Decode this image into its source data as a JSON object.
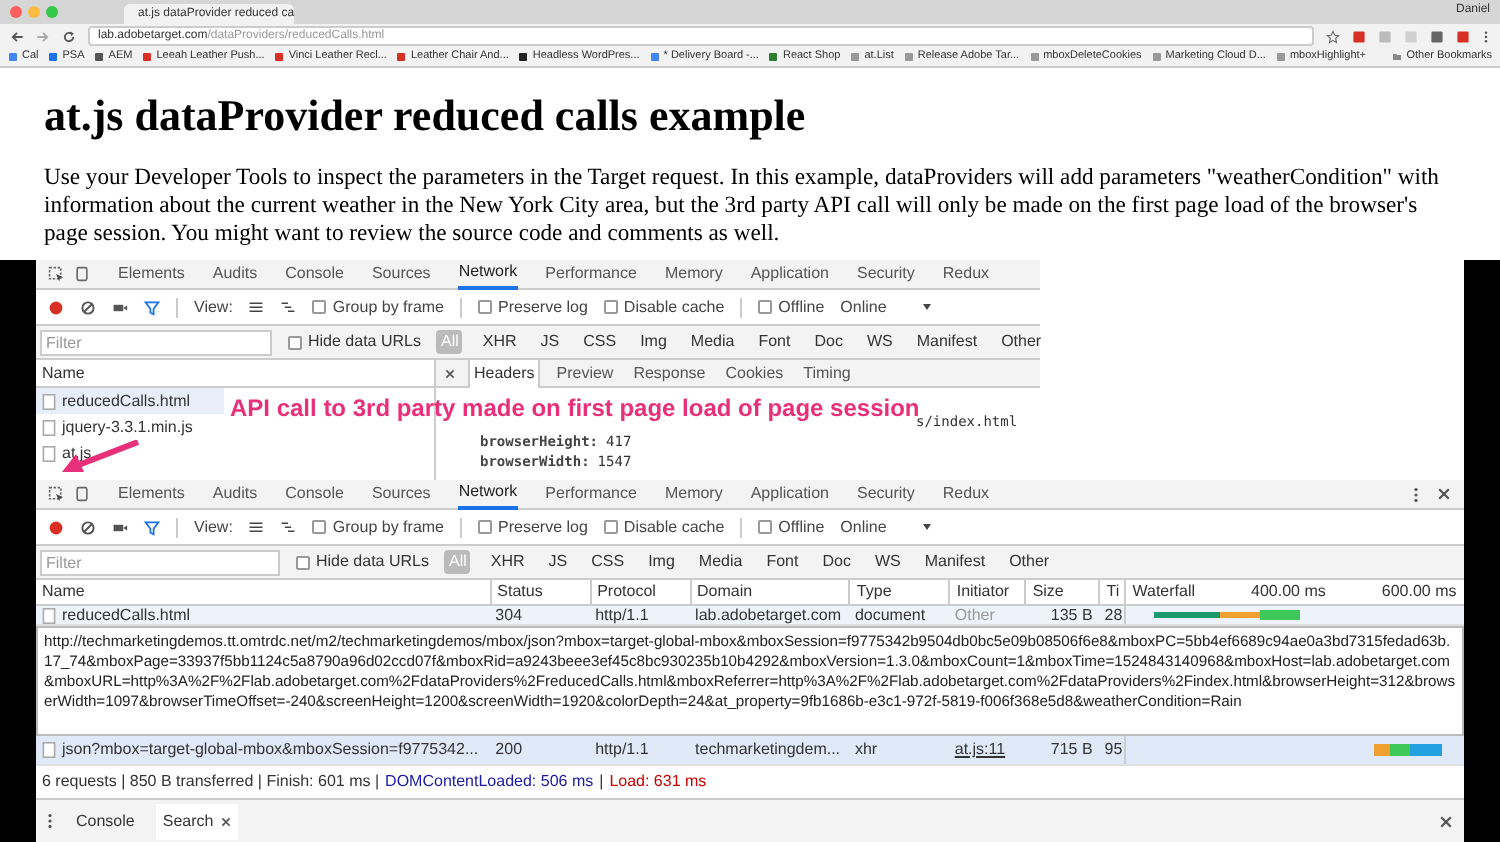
{
  "browser": {
    "tab_title": "at.js dataProvider reduced ca",
    "user": "Daniel",
    "url_host": "lab.adobetarget.com",
    "url_path": "/dataProviders/reducedCalls.html",
    "bookmarks": [
      "Cal",
      "PSA",
      "AEM",
      "Leeah Leather Push...",
      "Vinci Leather Recl...",
      "Leather Chair And...",
      "Headless WordPres...",
      "* Delivery Board -...",
      "React Shop",
      "at.List",
      "Release Adobe Tar...",
      "mboxDeleteCookies",
      "Marketing Cloud D...",
      "mboxHighlight+"
    ],
    "other_bookmarks": "Other Bookmarks"
  },
  "page": {
    "heading": "at.js dataProvider reduced calls example",
    "paragraph": "Use your Developer Tools to inspect the parameters in the Target request. In this example, dataProviders will add parameters \"weatherCondition\" with information about the current weather in the New York City area, but the 3rd party API call will only be made on the first page load of the browser's page session. You might want to review the source code and comments as well."
  },
  "devtools_screenshot": {
    "tabs": [
      {
        "label": "Elements",
        "selected": false
      },
      {
        "label": "Audits",
        "selected": false
      },
      {
        "label": "Console",
        "selected": false
      },
      {
        "label": "Sources",
        "selected": false
      },
      {
        "label": "Network",
        "selected": true
      },
      {
        "label": "Performance",
        "selected": false
      },
      {
        "label": "Memory",
        "selected": false
      },
      {
        "label": "Application",
        "selected": false
      },
      {
        "label": "Security",
        "selected": false
      },
      {
        "label": "Redux",
        "selected": false
      }
    ],
    "view_label": "View:",
    "checks": [
      {
        "label": "Group by frame",
        "checked": false
      },
      {
        "label": "Preserve log",
        "checked": false
      },
      {
        "label": "Disable cache",
        "checked": false
      },
      {
        "label": "Offline",
        "checked": false
      }
    ],
    "throttle": "Online",
    "filter_placeholder": "Filter",
    "hide_data_urls": {
      "label": "Hide data URLs",
      "checked": false
    },
    "type_filters": [
      {
        "label": "All",
        "selected": true
      },
      {
        "label": "XHR",
        "selected": false
      },
      {
        "label": "JS",
        "selected": false
      },
      {
        "label": "CSS",
        "selected": false
      },
      {
        "label": "Img",
        "selected": false
      },
      {
        "label": "Media",
        "selected": false
      },
      {
        "label": "Font",
        "selected": false
      },
      {
        "label": "Doc",
        "selected": false
      },
      {
        "label": "WS",
        "selected": false
      },
      {
        "label": "Manifest",
        "selected": false
      },
      {
        "label": "Other",
        "selected": false
      }
    ],
    "name_header": "Name",
    "files": [
      {
        "name": "reducedCalls.html",
        "selected": true
      },
      {
        "name": "jquery-3.3.1.min.js",
        "selected": false
      },
      {
        "name": "at.js",
        "selected": false
      }
    ],
    "detail_tabs": [
      {
        "label": "Headers",
        "selected": true
      },
      {
        "label": "Preview",
        "selected": false
      },
      {
        "label": "Response",
        "selected": false
      },
      {
        "label": "Cookies",
        "selected": false
      },
      {
        "label": "Timing",
        "selected": false
      }
    ],
    "url_fragment": "s/index.html",
    "params": [
      {
        "key": "browserHeight:",
        "value": "417"
      },
      {
        "key": "browserWidth:",
        "value": "1547"
      }
    ],
    "annotation": "API call to 3rd party made on first page load of page session"
  },
  "devtools": {
    "tabs": [
      {
        "label": "Elements",
        "selected": false
      },
      {
        "label": "Audits",
        "selected": false
      },
      {
        "label": "Console",
        "selected": false
      },
      {
        "label": "Sources",
        "selected": false
      },
      {
        "label": "Network",
        "selected": true
      },
      {
        "label": "Performance",
        "selected": false
      },
      {
        "label": "Memory",
        "selected": false
      },
      {
        "label": "Application",
        "selected": false
      },
      {
        "label": "Security",
        "selected": false
      },
      {
        "label": "Redux",
        "selected": false
      }
    ],
    "view_label": "View:",
    "checks": [
      {
        "label": "Group by frame",
        "checked": false
      },
      {
        "label": "Preserve log",
        "checked": false
      },
      {
        "label": "Disable cache",
        "checked": false
      },
      {
        "label": "Offline",
        "checked": false
      }
    ],
    "throttle": "Online",
    "filter_placeholder": "Filter",
    "hide_data_urls": {
      "label": "Hide data URLs",
      "checked": false
    },
    "type_filters": [
      {
        "label": "All",
        "selected": true
      },
      {
        "label": "XHR",
        "selected": false
      },
      {
        "label": "JS",
        "selected": false
      },
      {
        "label": "CSS",
        "selected": false
      },
      {
        "label": "Img",
        "selected": false
      },
      {
        "label": "Media",
        "selected": false
      },
      {
        "label": "Font",
        "selected": false
      },
      {
        "label": "Doc",
        "selected": false
      },
      {
        "label": "WS",
        "selected": false
      },
      {
        "label": "Manifest",
        "selected": false
      },
      {
        "label": "Other",
        "selected": false
      }
    ],
    "columns": [
      "Name",
      "Status",
      "Protocol",
      "Domain",
      "Type",
      "Initiator",
      "Size",
      "Ti",
      "Waterfall"
    ],
    "waterfall_ticks": [
      "400.00 ms",
      "600.00 ms"
    ],
    "rows": [
      {
        "cells": [
          "reducedCalls.html",
          "304",
          "http/1.1",
          "lab.adobetarget.com",
          "document",
          "Other",
          "135 B",
          "28"
        ],
        "initiator_link": false,
        "selected": false
      },
      {
        "cells": [
          "json?mbox=target-global-mbox&mboxSession=f9775342...",
          "200",
          "http/1.1",
          "techmarketingdem...",
          "xhr",
          "at.js:11",
          "715 B",
          "95"
        ],
        "initiator_link": true,
        "selected": true
      }
    ],
    "tooltip": "http://techmarketingdemos.tt.omtrdc.net/m2/techmarketingdemos/mbox/json?mbox=target-global-mbox&mboxSession=f9775342b9504db0bc5e09b08506f6e8&mboxPC=5bb4ef6689c94ae0a3bd7315fedad63b.17_74&mboxPage=33937f5bb1124c5a8790a96d02ccd07f&mboxRid=a9243beee3ef45c8bc930235b10b4292&mboxVersion=1.3.0&mboxCount=1&mboxTime=1524843140968&mboxHost=lab.adobetarget.com&mboxURL=http%3A%2F%2Flab.adobetarget.com%2FdataProviders%2FreducedCalls.html&mboxReferrer=http%3A%2F%2Flab.adobetarget.com%2FdataProviders%2Findex.html&browserHeight=312&browserWidth=1097&browserTimeOffset=-240&screenHeight=1200&screenWidth=1920&colorDepth=24&at_property=9fb1686b-e3c1-972f-5819-f006f368e5d8&weatherCondition=Rain",
    "summary": [
      {
        "text": "6 requests | 850 B transferred | Finish: 601 ms |",
        "kind": "plain"
      },
      {
        "text": "DOMContentLoaded: 506 ms",
        "kind": "dcl"
      },
      {
        "text": "|",
        "kind": "plain"
      },
      {
        "text": "Load: 631 ms",
        "kind": "load"
      }
    ],
    "drawer_tabs": [
      {
        "label": "Console",
        "selected": false,
        "closable": false
      },
      {
        "label": "Search",
        "selected": true,
        "closable": true
      }
    ]
  }
}
